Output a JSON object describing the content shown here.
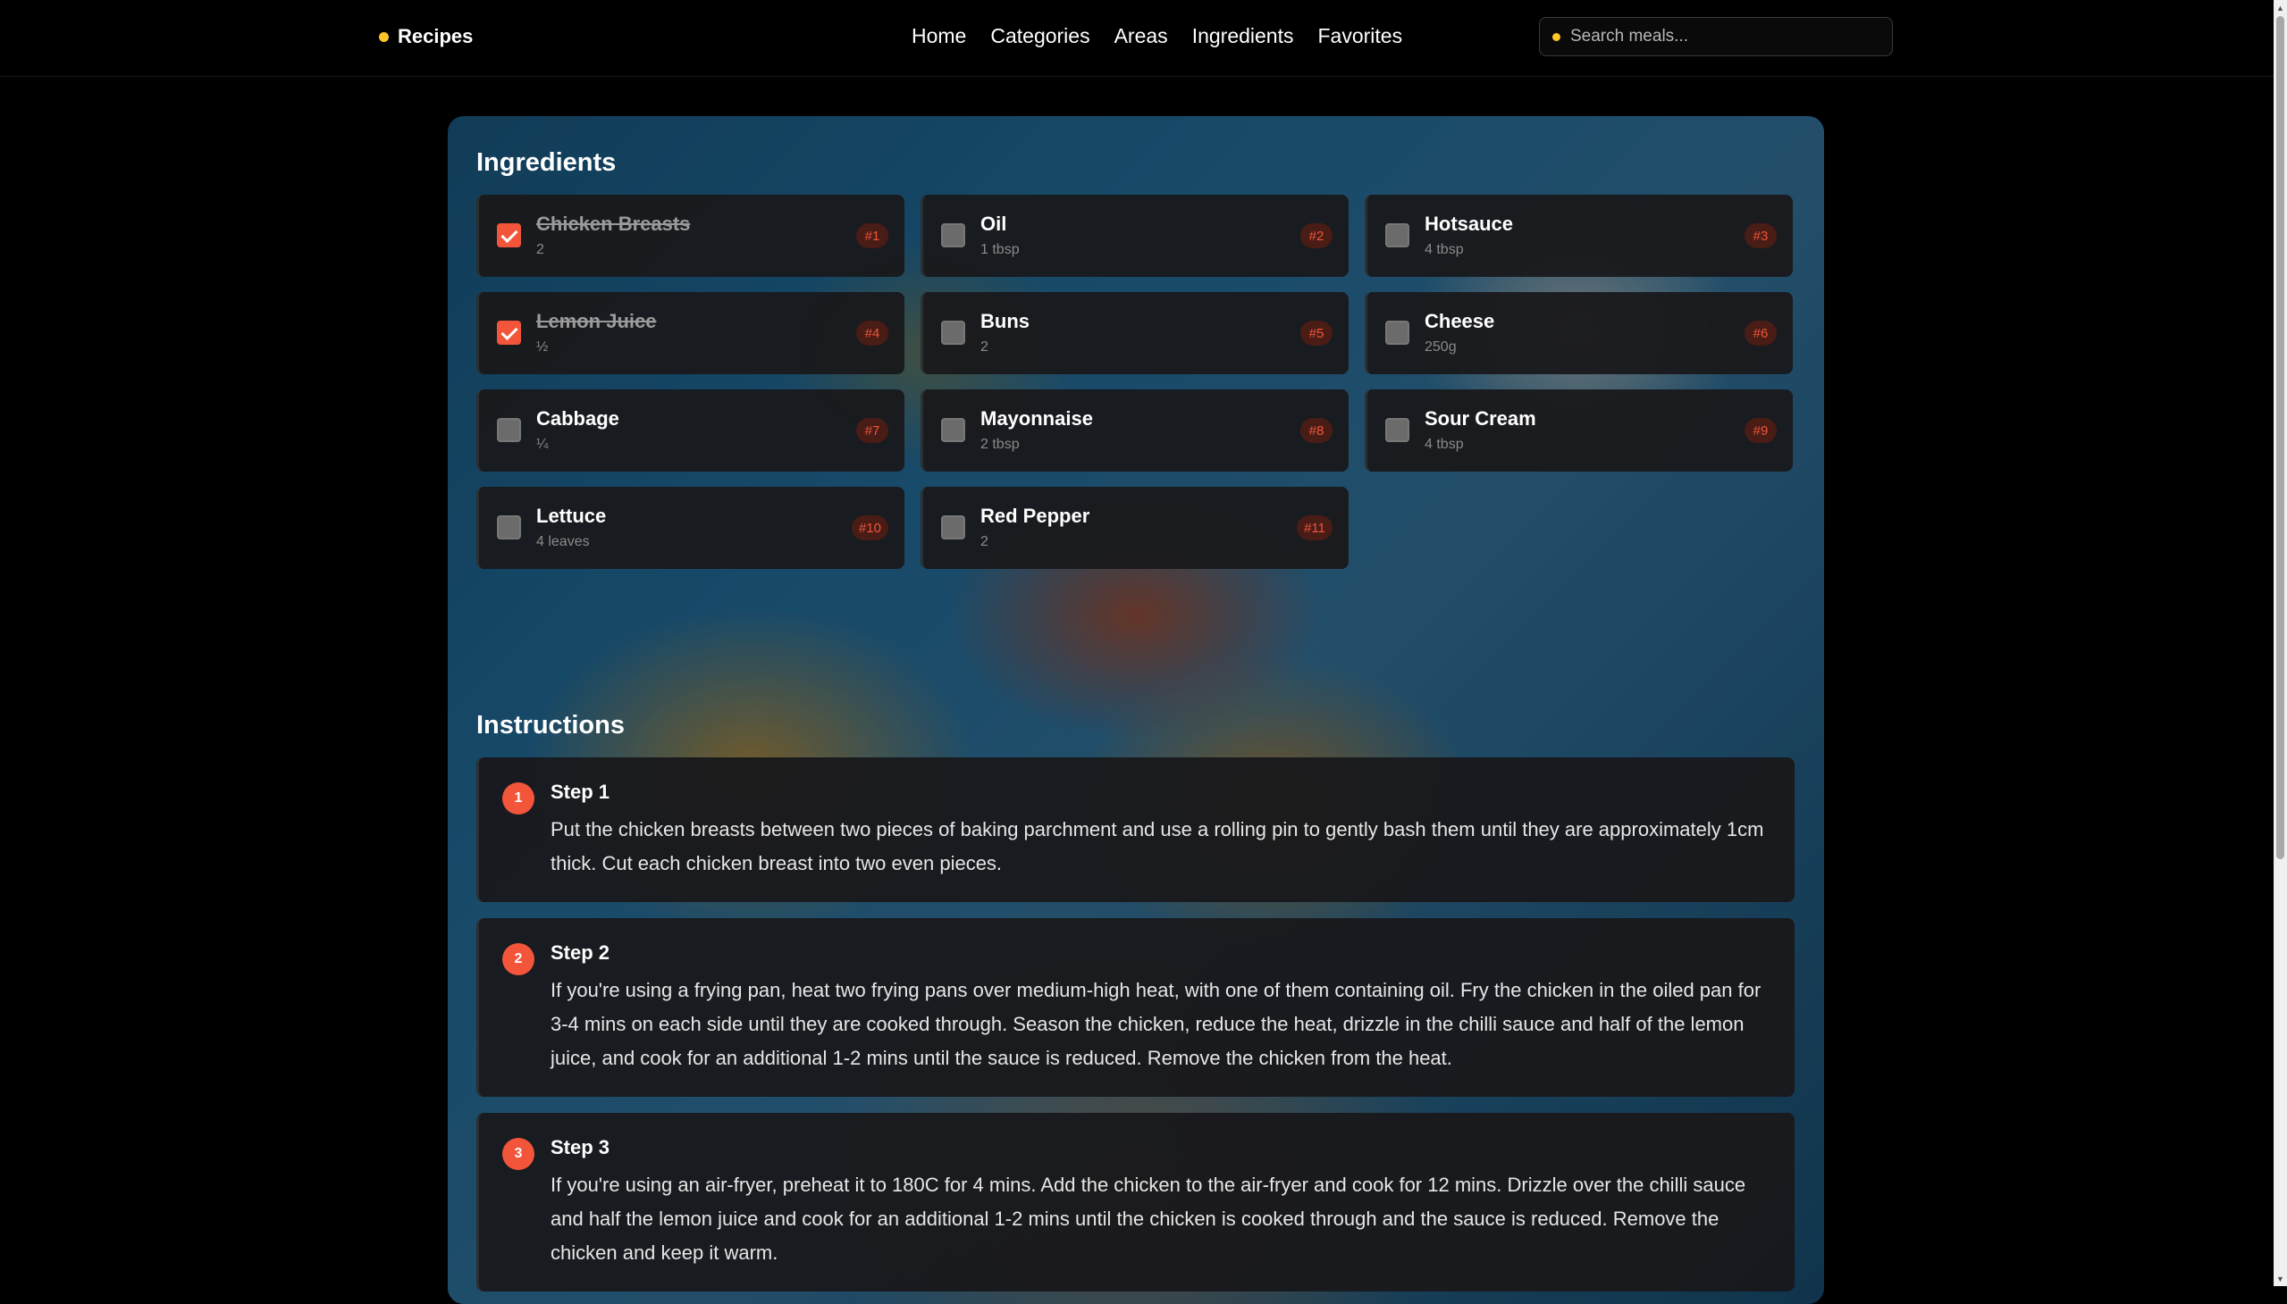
{
  "header": {
    "brand": "Recipes",
    "nav": [
      "Home",
      "Categories",
      "Areas",
      "Ingredients",
      "Favorites"
    ],
    "search_placeholder": "Search meals..."
  },
  "ingredients": {
    "title": "Ingredients",
    "items": [
      {
        "name": "Chicken Breasts",
        "measure": "2",
        "badge": "#1",
        "checked": true
      },
      {
        "name": "Oil",
        "measure": "1 tbsp",
        "badge": "#2",
        "checked": false
      },
      {
        "name": "Hotsauce",
        "measure": "4 tbsp",
        "badge": "#3",
        "checked": false
      },
      {
        "name": "Lemon Juice",
        "measure": "½",
        "badge": "#4",
        "checked": true
      },
      {
        "name": "Buns",
        "measure": "2",
        "badge": "#5",
        "checked": false
      },
      {
        "name": "Cheese",
        "measure": "250g",
        "badge": "#6",
        "checked": false
      },
      {
        "name": "Cabbage",
        "measure": "¼",
        "badge": "#7",
        "checked": false
      },
      {
        "name": "Mayonnaise",
        "measure": "2 tbsp",
        "badge": "#8",
        "checked": false
      },
      {
        "name": "Sour Cream",
        "measure": "4 tbsp",
        "badge": "#9",
        "checked": false
      },
      {
        "name": "Lettuce",
        "measure": "4 leaves",
        "badge": "#10",
        "checked": false
      },
      {
        "name": "Red Pepper",
        "measure": "2",
        "badge": "#11",
        "checked": false
      }
    ]
  },
  "instructions": {
    "title": "Instructions",
    "steps": [
      {
        "num": "1",
        "title": "Step 1",
        "text": "Put the chicken breasts between two pieces of baking parchment and use a rolling pin to gently bash them until they are approximately 1cm thick. Cut each chicken breast into two even pieces."
      },
      {
        "num": "2",
        "title": "Step 2",
        "text": "If you're using a frying pan, heat two frying pans over medium-high heat, with one of them containing oil. Fry the chicken in the oiled pan for 3-4 mins on each side until they are cooked through. Season the chicken, reduce the heat, drizzle in the chilli sauce and half of the lemon juice, and cook for an additional 1-2 mins until the sauce is reduced. Remove the chicken from the heat."
      },
      {
        "num": "3",
        "title": "Step 3",
        "text": "If you're using an air-fryer, preheat it to 180C for 4 mins. Add the chicken to the air-fryer and cook for 12 mins. Drizzle over the chilli sauce and half the lemon juice and cook for an additional 1-2 mins until the chicken is cooked through and the sauce is reduced. Remove the chicken and keep it warm."
      }
    ]
  },
  "colors": {
    "accent": "#f2553a",
    "brand_dot": "#ffc62a"
  }
}
